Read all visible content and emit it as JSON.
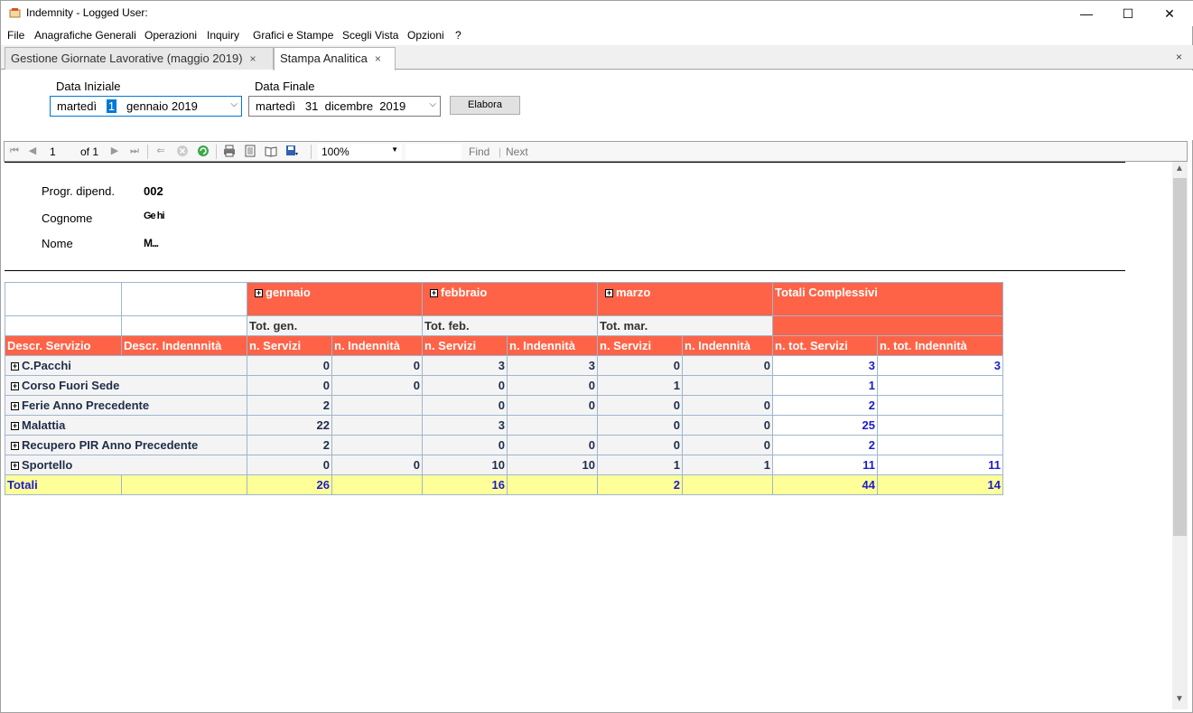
{
  "window": {
    "title": "Indemnity - Logged User:",
    "min_icon": "—",
    "max_icon": "☐",
    "close_icon": "✕"
  },
  "menu": [
    "File",
    "Anagrafiche Generali",
    "Operazioni",
    "Inquiry",
    "Grafici e Stampe",
    "Scegli Vista",
    "Opzioni",
    "?"
  ],
  "tabs": [
    {
      "label": "Gestione Giornate Lavorative (maggio 2019)",
      "close": "×"
    },
    {
      "label": "Stampa Analitica",
      "close": "×"
    }
  ],
  "tabstrip_close": "×",
  "filters": {
    "start_label": "Data Iniziale",
    "start_weekday": "martedì",
    "start_day": "1",
    "start_rest": "gennaio   2019",
    "end_label": "Data Finale",
    "end_value": "martedì   31  dicembre  2019",
    "elabora_label": "Elabora"
  },
  "report_toolbar": {
    "page": "1",
    "of_pages": "of 1",
    "zoom": "100%",
    "find": "Find",
    "sep": "|",
    "next": "Next"
  },
  "employee": {
    "prog_label": "Progr. dipend.",
    "prog_value": "002",
    "cognome_label": "Cognome",
    "cognome_value": "Ge  hi",
    "nome_label": "Nome",
    "nome_value": "M..."
  },
  "pivot": {
    "months": [
      "gennaio",
      "febbraio",
      "marzo"
    ],
    "totali_complessivi": "Totali Complessivi",
    "month_totals": [
      "Tot. gen.",
      "Tot. feb.",
      "Tot. mar."
    ],
    "headers": [
      "Descr. Servizio",
      "Descr. Indennnità",
      "n. Servizi",
      "n. Indennità",
      "n. Servizi",
      "n. Indennità",
      "n. Servizi",
      "n. Indennità",
      "n. tot. Servizi",
      "n. tot. Indennità"
    ],
    "rows": [
      {
        "name": "C.Pacchi",
        "values": [
          "0",
          "0",
          "3",
          "3",
          "0",
          "0"
        ],
        "tot": [
          "3",
          "3"
        ]
      },
      {
        "name": "Corso Fuori Sede",
        "values": [
          "0",
          "0",
          "0",
          "0",
          "1",
          ""
        ],
        "tot": [
          "1",
          ""
        ]
      },
      {
        "name": "Ferie Anno Precedente",
        "values": [
          "2",
          "",
          "0",
          "0",
          "0",
          "0"
        ],
        "tot": [
          "2",
          ""
        ]
      },
      {
        "name": "Malattia",
        "values": [
          "22",
          "",
          "3",
          "",
          "0",
          "0"
        ],
        "tot": [
          "25",
          ""
        ]
      },
      {
        "name": "Recupero PIR Anno Precedente",
        "values": [
          "2",
          "",
          "0",
          "0",
          "0",
          "0"
        ],
        "tot": [
          "2",
          ""
        ]
      },
      {
        "name": "Sportello",
        "values": [
          "0",
          "0",
          "10",
          "10",
          "1",
          "1"
        ],
        "tot": [
          "11",
          "11"
        ]
      }
    ],
    "totals": {
      "label": "Totali",
      "values": [
        "26",
        "",
        "16",
        "",
        "2",
        ""
      ],
      "tot": [
        "44",
        "14"
      ]
    }
  }
}
